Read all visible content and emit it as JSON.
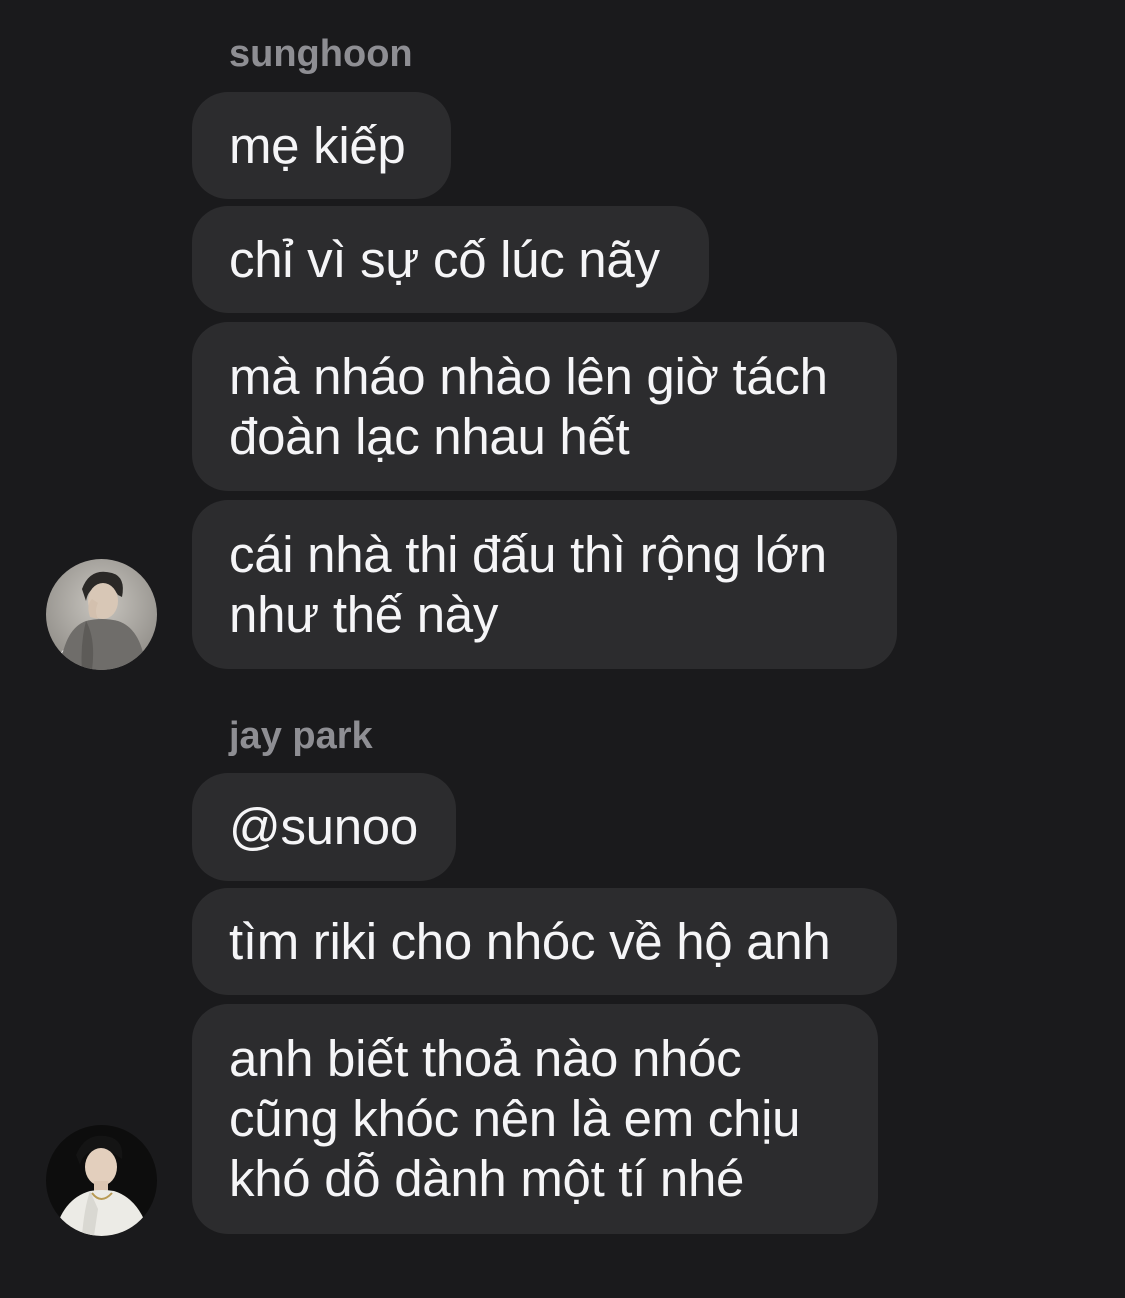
{
  "chat": {
    "groups": [
      {
        "sender": "sunghoon",
        "avatar_icon": "user-avatar-sunghoon",
        "messages": [
          "mẹ kiếp",
          "chỉ vì sự cố lúc nãy",
          "mà nháo nhào lên giờ tách\nđoàn lạc nhau hết",
          "cái nhà thi đấu thì rộng lớn\nnhư thế này"
        ]
      },
      {
        "sender": "jay park",
        "avatar_icon": "user-avatar-jay-park",
        "messages": [
          "@sunoo",
          "tìm riki cho nhóc về hộ anh",
          "anh biết thoả nào nhóc\ncũng khóc nên là em chịu\nkhó dỗ dành một tí nhé"
        ]
      }
    ]
  },
  "colors": {
    "background": "#1a1a1c",
    "bubble": "#2c2c2e",
    "sender_name": "#8e8e93",
    "message_text": "#f5f5f7"
  }
}
